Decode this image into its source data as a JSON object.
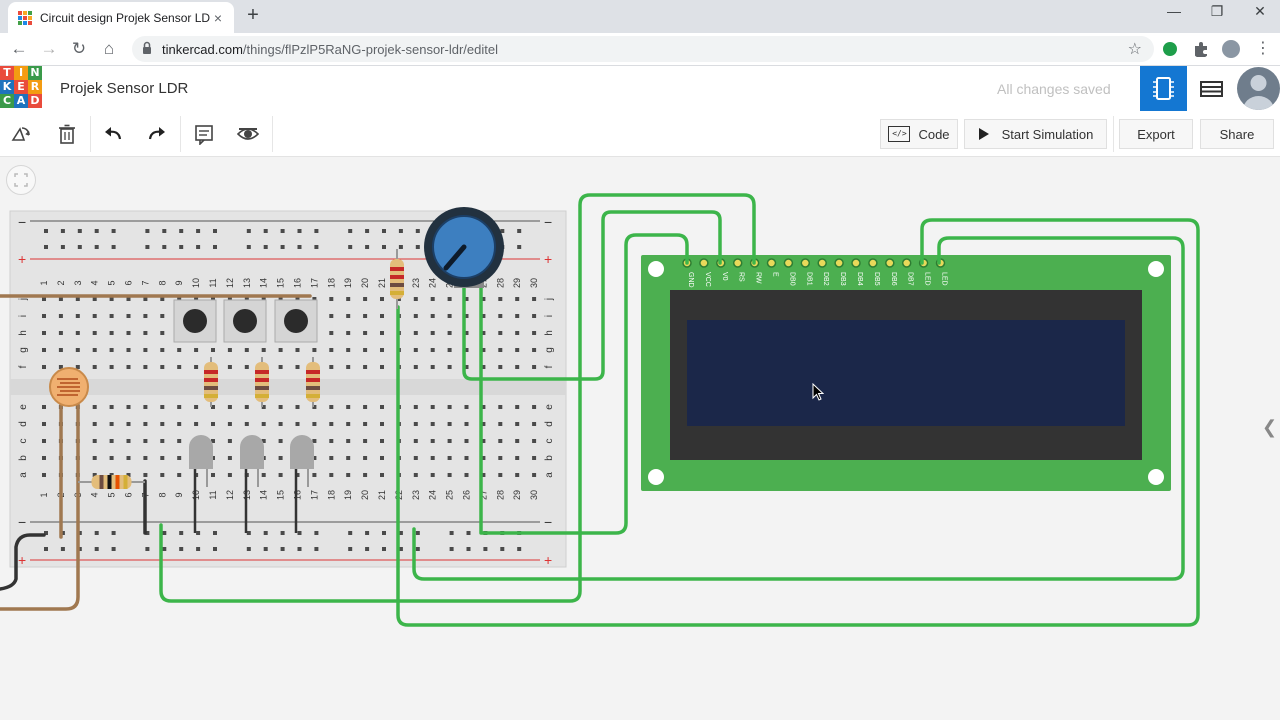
{
  "browser": {
    "tab_title": "Circuit design Projek Sensor LDR",
    "tab_close": "×",
    "new_tab": "+",
    "url_domain": "tinkercad.com",
    "url_path": "/things/flPzlP5RaNG-projek-sensor-ldr/editel",
    "back": "←",
    "forward": "→",
    "reload": "↻",
    "home": "⌂",
    "minimize": "—",
    "maximize": "❐",
    "close": "✕",
    "menu": "⋮",
    "star": "☆"
  },
  "logo": {
    "letters": [
      "T",
      "I",
      "N",
      "K",
      "E",
      "R",
      "C",
      "A",
      "D"
    ]
  },
  "header": {
    "project_name": "Projek Sensor LDR",
    "save_status": "All changes saved"
  },
  "toolbar": {
    "code_label": "Code",
    "code_icon_text": "</>",
    "start_simulation_label": "Start Simulation",
    "export_label": "Export",
    "share_label": "Share"
  },
  "breadboard": {
    "columns_top": [
      "1",
      "2",
      "3",
      "4",
      "5",
      "6",
      "7",
      "8",
      "9",
      "10",
      "11",
      "12",
      "13",
      "14",
      "15",
      "16",
      "17",
      "18",
      "19",
      "20",
      "21",
      "22",
      "23",
      "24",
      "25",
      "26",
      "27",
      "28",
      "29",
      "30"
    ],
    "rows_upper": [
      "j",
      "i",
      "h",
      "g",
      "f"
    ],
    "rows_lower": [
      "e",
      "d",
      "c",
      "b",
      "a"
    ],
    "rail_plus": "+",
    "rail_minus": "−"
  },
  "lcd": {
    "pins": [
      "GND",
      "VCC",
      "V0",
      "RS",
      "RW",
      "E",
      "DB0",
      "DB1",
      "DB2",
      "DB3",
      "DB4",
      "DB5",
      "DB6",
      "DB7",
      "LED",
      "LED"
    ]
  },
  "sidebar_toggle": "❮",
  "colors": {
    "accent_blue": "#1477d2",
    "wire_green": "#3cb54a",
    "wire_brown": "#a07850",
    "lcd_board": "#4caf50",
    "lcd_screen": "#1b2749",
    "pot_knob": "#3d7fc0"
  },
  "icons": {
    "rotate": "rotate-icon",
    "delete": "trash-icon",
    "undo": "undo-icon",
    "redo": "redo-icon",
    "notes": "notes-icon",
    "visibility": "eye-icon",
    "play": "play-icon",
    "components_view": "chip-icon",
    "schematic_view": "list-view-icon"
  }
}
